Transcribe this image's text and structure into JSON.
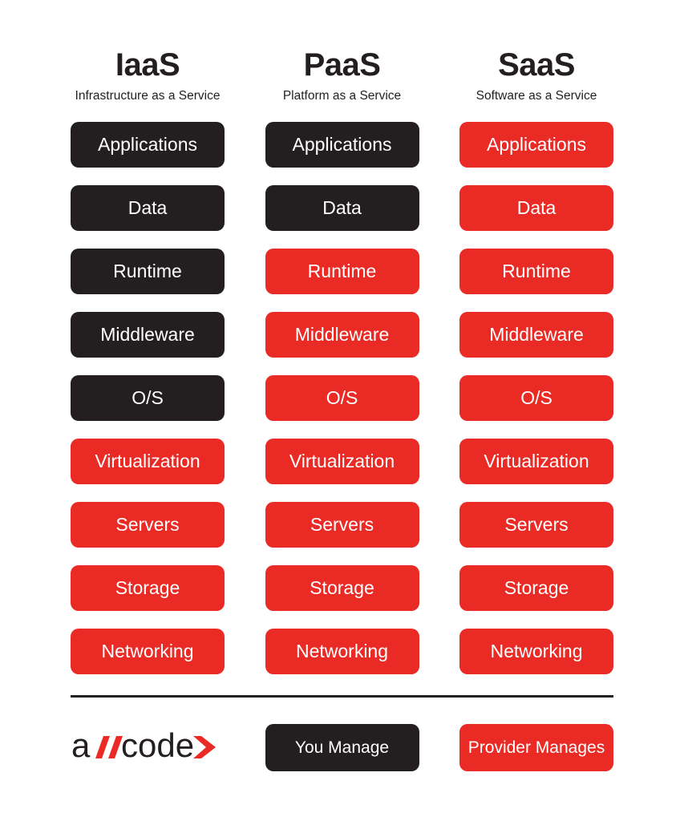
{
  "columns": [
    {
      "title": "IaaS",
      "subtitle": "Infrastructure as a Service"
    },
    {
      "title": "PaaS",
      "subtitle": "Platform as a Service"
    },
    {
      "title": "SaaS",
      "subtitle": "Software as a Service"
    }
  ],
  "rows": [
    {
      "label": "Applications",
      "iaas": "dark",
      "paas": "dark",
      "saas": "red"
    },
    {
      "label": "Data",
      "iaas": "dark",
      "paas": "dark",
      "saas": "red"
    },
    {
      "label": "Runtime",
      "iaas": "dark",
      "paas": "red",
      "saas": "red"
    },
    {
      "label": "Middleware",
      "iaas": "dark",
      "paas": "red",
      "saas": "red"
    },
    {
      "label": "O/S",
      "iaas": "dark",
      "paas": "red",
      "saas": "red"
    },
    {
      "label": "Virtualization",
      "iaas": "red",
      "paas": "red",
      "saas": "red"
    },
    {
      "label": "Servers",
      "iaas": "red",
      "paas": "red",
      "saas": "red"
    },
    {
      "label": "Storage",
      "iaas": "red",
      "paas": "red",
      "saas": "red"
    },
    {
      "label": "Networking",
      "iaas": "red",
      "paas": "red",
      "saas": "red"
    }
  ],
  "legend": {
    "you_manage": "You Manage",
    "provider_manages": "Provider Manages"
  },
  "logo": {
    "text_a": "a",
    "text_slashes": "//",
    "text_code": "code",
    "chevron": ">"
  },
  "colors": {
    "dark": "#231f20",
    "red": "#ea2a25",
    "background": "#ffffff",
    "text_on_fill": "#ffffff"
  },
  "chart_data": {
    "type": "table",
    "title": "Cloud Service Models Responsibility Stack",
    "categories": [
      "IaaS",
      "PaaS",
      "SaaS"
    ],
    "x": [
      "Applications",
      "Data",
      "Runtime",
      "Middleware",
      "O/S",
      "Virtualization",
      "Servers",
      "Storage",
      "Networking"
    ],
    "legend": [
      "You Manage",
      "Provider Manages"
    ],
    "series": [
      {
        "name": "IaaS",
        "values": [
          "You Manage",
          "You Manage",
          "You Manage",
          "You Manage",
          "You Manage",
          "Provider Manages",
          "Provider Manages",
          "Provider Manages",
          "Provider Manages"
        ]
      },
      {
        "name": "PaaS",
        "values": [
          "You Manage",
          "You Manage",
          "Provider Manages",
          "Provider Manages",
          "Provider Manages",
          "Provider Manages",
          "Provider Manages",
          "Provider Manages",
          "Provider Manages"
        ]
      },
      {
        "name": "SaaS",
        "values": [
          "Provider Manages",
          "Provider Manages",
          "Provider Manages",
          "Provider Manages",
          "Provider Manages",
          "Provider Manages",
          "Provider Manages",
          "Provider Manages",
          "Provider Manages"
        ]
      }
    ],
    "xlabel": "",
    "ylabel": "",
    "grid": false,
    "legend_position": "bottom"
  }
}
